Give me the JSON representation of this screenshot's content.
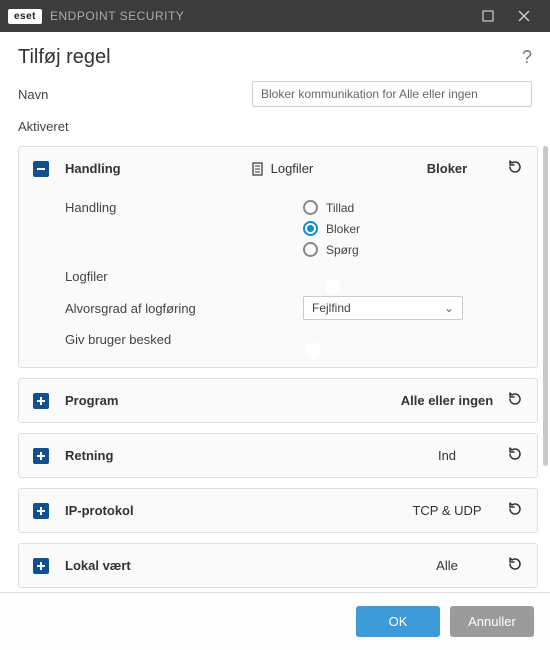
{
  "app": {
    "brand": "eset",
    "name": "ENDPOINT SECURITY"
  },
  "dialog": {
    "title": "Tilføj regel",
    "name_label": "Navn",
    "name_value": "Bloker kommunikation for Alle eller ingen",
    "enabled_label": "Aktiveret"
  },
  "action_card": {
    "title": "Handling",
    "logfiles_label": "Logfiler",
    "summary_value": "Bloker",
    "handling_label": "Handling",
    "radios": {
      "allow": "Tillad",
      "block": "Bloker",
      "ask": "Spørg"
    },
    "logfiles_row_label": "Logfiler",
    "severity_label": "Alvorsgrad af logføring",
    "severity_value": "Fejlfind",
    "notify_label": "Giv bruger besked"
  },
  "cards": {
    "program": {
      "title": "Program",
      "value": "Alle eller ingen"
    },
    "direction": {
      "title": "Retning",
      "value": "Ind"
    },
    "protocol": {
      "title": "IP-protokol",
      "value": "TCP & UDP"
    },
    "localhost": {
      "title": "Lokal vært",
      "value": "Alle"
    }
  },
  "footer": {
    "ok": "OK",
    "cancel": "Annuller"
  }
}
